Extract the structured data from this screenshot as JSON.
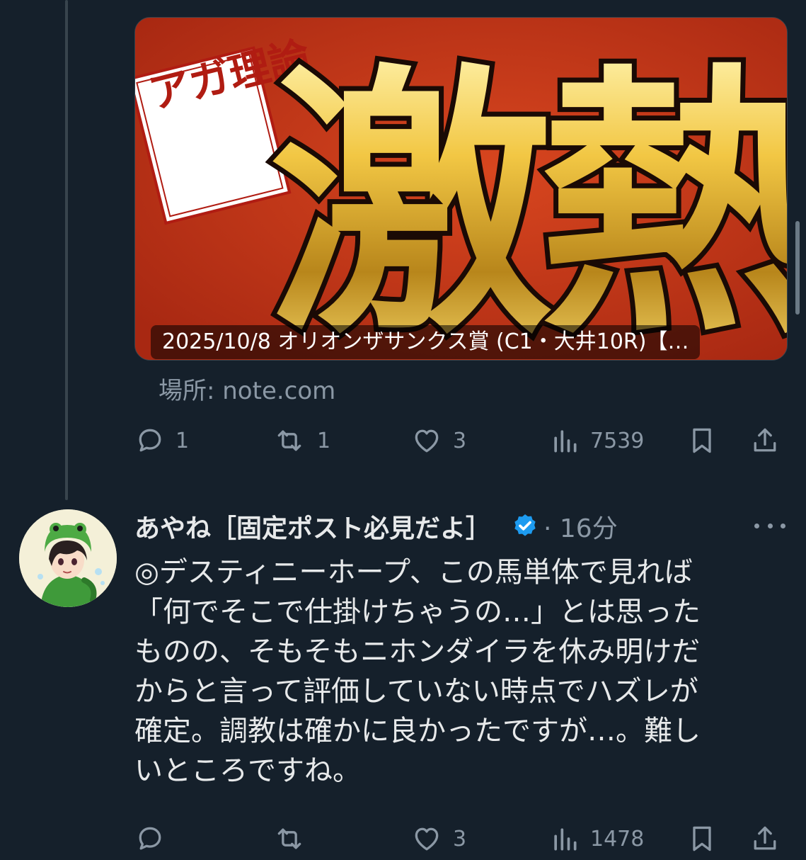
{
  "upper_post": {
    "card": {
      "stamp_text": "アガ理論",
      "headline": "激熱",
      "caption": "2025/10/8 オリオンザサンクス賞 (C1・大井10R)【…",
      "domain": "場所: note.com"
    },
    "actions": {
      "reply_count": "1",
      "repost_count": "1",
      "like_count": "3",
      "view_count": "7539"
    }
  },
  "reply_post": {
    "author_name": "あやね［固定ポスト必見だよ］",
    "verified": true,
    "time": "· 16分",
    "text_lines": [
      "◎デスティニーホープ、この馬単体で見れば",
      "「何でそこで仕掛けちゃうの…」とは思った",
      "ものの、そもそもニホンダイラを休み明けだ",
      "からと言って評価していない時点でハズレが",
      "確定。調教は確かに良かったですが…。難し",
      "いところですね。"
    ],
    "actions": {
      "reply_count": "",
      "repost_count": "",
      "like_count": "3",
      "view_count": "1478"
    }
  },
  "colors": {
    "background": "#15202b",
    "text_primary": "#e7e9ea",
    "text_secondary": "#8b98a5",
    "verified_blue": "#1d9bf0",
    "card_red": "#c0341c",
    "card_gold": "#f2c744"
  }
}
